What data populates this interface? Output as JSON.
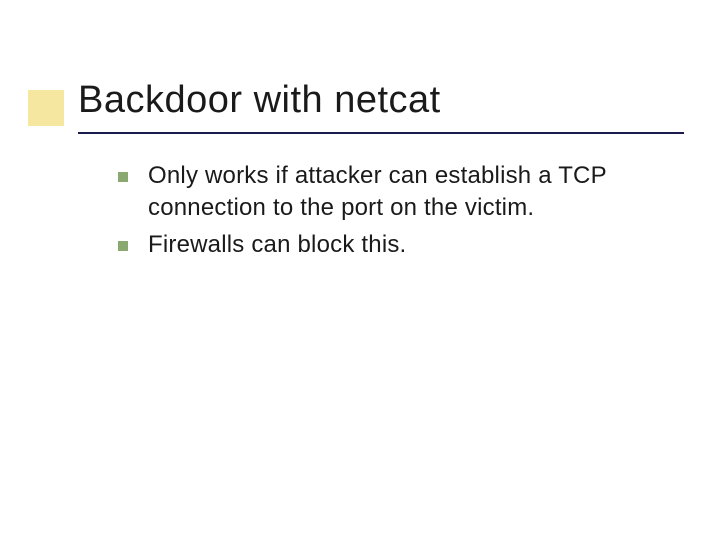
{
  "slide": {
    "title": "Backdoor with netcat",
    "bullets": [
      {
        "text": "Only works if attacker can establish a TCP connection to the port on the victim."
      },
      {
        "text": "Firewalls can block this."
      }
    ]
  }
}
